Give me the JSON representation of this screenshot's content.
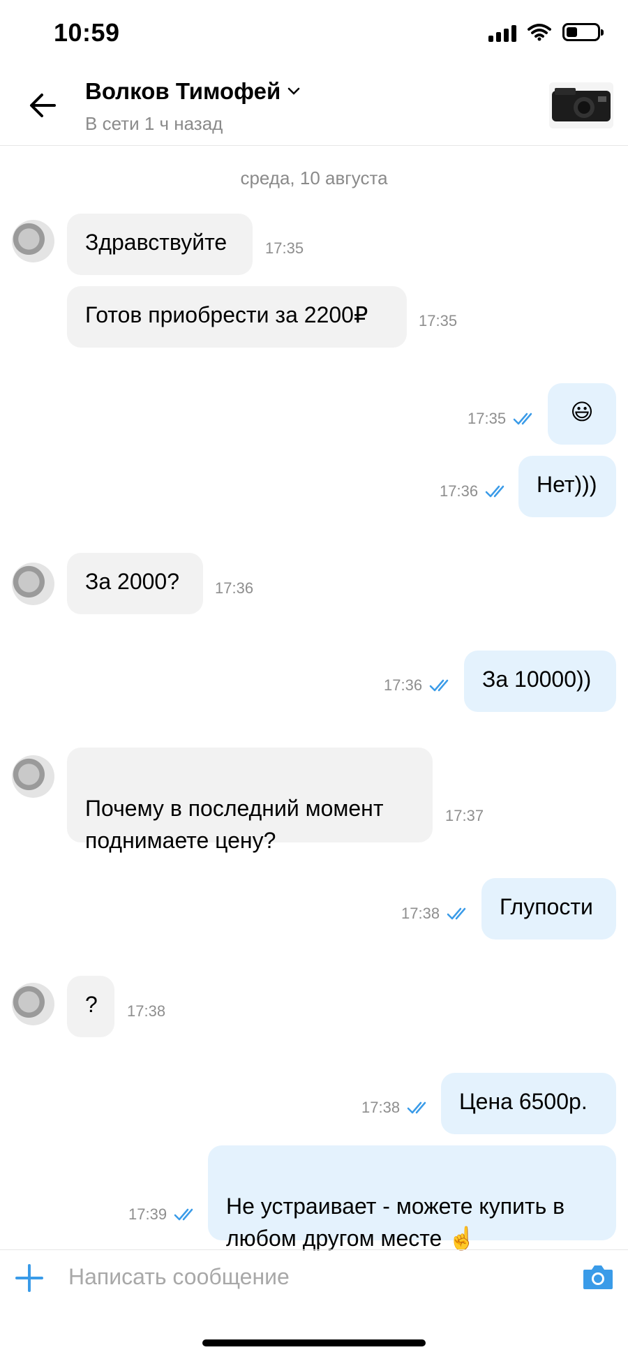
{
  "status_bar": {
    "time": "10:59",
    "icons": [
      "signal-icon",
      "wifi-icon",
      "battery-icon"
    ],
    "battery_level": 0.3
  },
  "header": {
    "contact_name": "Волков Тимофей",
    "contact_status": "В сети 1 ч назад",
    "icons": [
      "back-arrow-icon",
      "chevron-down-icon",
      "product-thumbnail"
    ]
  },
  "chat": {
    "date_separator": "среда, 10 августа",
    "messages": [
      {
        "dir": "in",
        "text": "Здравствуйте",
        "time": "17:35"
      },
      {
        "dir": "in",
        "text": "Готов приобрести за 2200₽",
        "time": "17:35"
      },
      {
        "dir": "out",
        "text": "😃",
        "time": "17:35"
      },
      {
        "dir": "out",
        "text": "Нет)))",
        "time": "17:36"
      },
      {
        "dir": "in",
        "text": "За 2000?",
        "time": "17:36"
      },
      {
        "dir": "out",
        "text": "За 10000))",
        "time": "17:36"
      },
      {
        "dir": "in",
        "text": "Почему в последний момент\nподнимаете цену?",
        "time": "17:37"
      },
      {
        "dir": "out",
        "text": "Глупости",
        "time": "17:38"
      },
      {
        "dir": "in",
        "text": "?",
        "time": "17:38"
      },
      {
        "dir": "out",
        "text": "Цена 6500р.",
        "time": "17:38"
      },
      {
        "dir": "out",
        "text": "Не устраивает - можете купить в\nлюбом другом месте ☝️",
        "time": "17:39"
      }
    ]
  },
  "input": {
    "placeholder": "Написать сообщение",
    "icons": [
      "plus-icon",
      "camera-icon"
    ]
  },
  "colors": {
    "accent": "#3a9be8",
    "incoming_bubble": "#f2f2f2",
    "outgoing_bubble": "#e4f2fd",
    "muted_text": "#8a8a8a"
  }
}
